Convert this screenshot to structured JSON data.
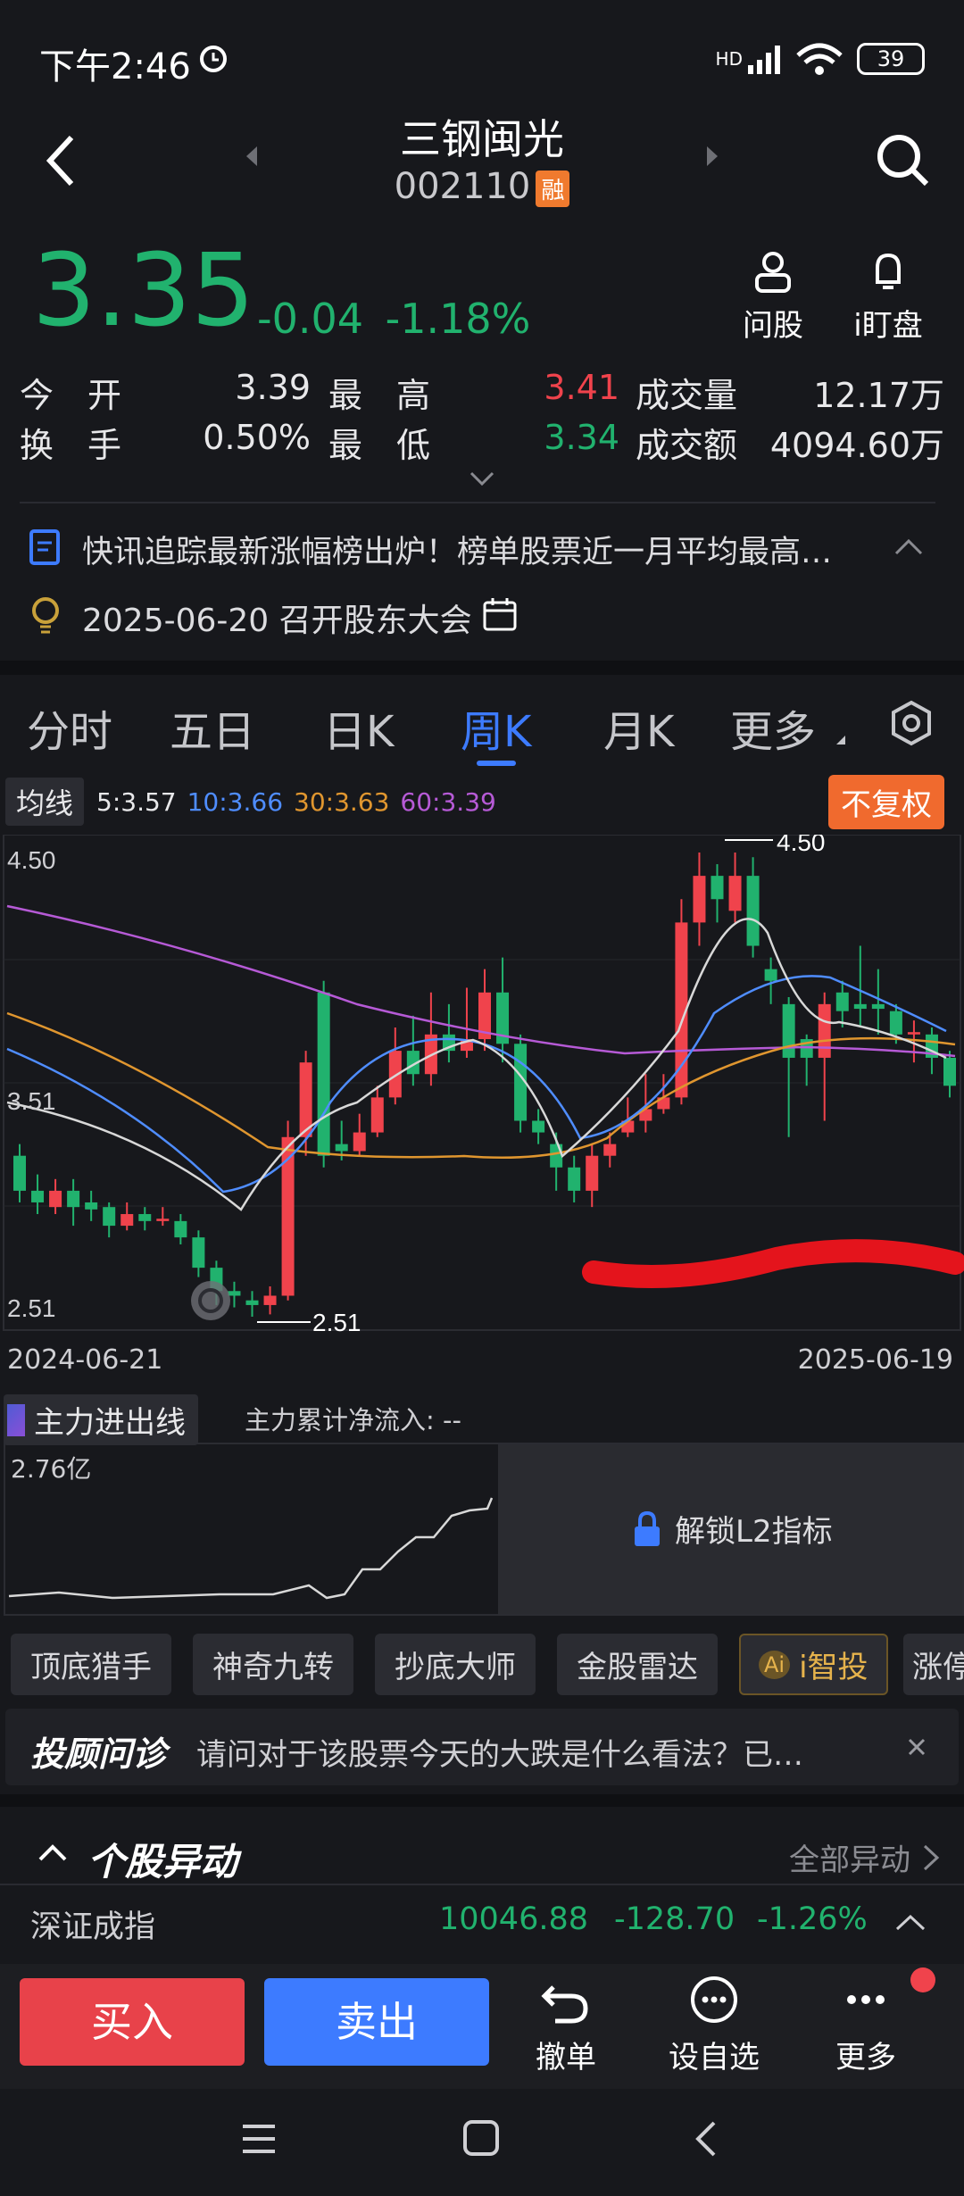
{
  "status": {
    "time": "下午2:46",
    "battery": "39",
    "network": "HD"
  },
  "header": {
    "title": "三钢闽光",
    "code": "002110",
    "margin_badge": "融"
  },
  "quote": {
    "price": "3.35",
    "change": "-0.04",
    "change_pct": "-1.18%",
    "actions": [
      {
        "label": "问股",
        "icon": "person-icon"
      },
      {
        "label": "i盯盘",
        "icon": "bell-icon"
      }
    ],
    "stats": {
      "open_label": "今　开",
      "open": "3.39",
      "high_label": "最　高",
      "high": "3.41",
      "volume_label": "成交量",
      "volume": "12.17万",
      "turnover_label": "换　手",
      "turnover": "0.50%",
      "low_label": "最　低",
      "low": "3.34",
      "amount_label": "成交额",
      "amount": "4094.60万"
    }
  },
  "news": {
    "text": "快讯追踪最新涨幅榜出炉！榜单股票近一月平均最高…",
    "event": "2025-06-20 召开股东大会"
  },
  "tabs": [
    {
      "label": "分时",
      "active": false
    },
    {
      "label": "五日",
      "active": false
    },
    {
      "label": "日K",
      "active": false
    },
    {
      "label": "周K",
      "active": true
    },
    {
      "label": "月K",
      "active": false
    },
    {
      "label": "更多",
      "active": false
    }
  ],
  "ma": {
    "selector": "均线",
    "items": [
      {
        "label": "5:3.57",
        "color": "#e6e6e6"
      },
      {
        "label": "10:3.66",
        "color": "#4f8dff"
      },
      {
        "label": "30:3.63",
        "color": "#e0962f"
      },
      {
        "label": "60:3.39",
        "color": "#b65ad6"
      }
    ],
    "adjust": "不复权"
  },
  "chart_data": {
    "type": "candlestick",
    "y_ticks": [
      "4.50",
      "3.51",
      "2.51"
    ],
    "x_start": "2024-06-21",
    "x_end": "2025-06-19",
    "annotations": [
      {
        "label": "4.50"
      },
      {
        "label": "2.51"
      }
    ],
    "ylim": [
      2.51,
      4.5
    ],
    "candles": [
      [
        3.2,
        3.05,
        3.25,
        3.0
      ],
      [
        3.05,
        3.0,
        3.12,
        2.95
      ],
      [
        2.98,
        3.05,
        3.1,
        2.95
      ],
      [
        3.05,
        2.98,
        3.1,
        2.9
      ],
      [
        3.0,
        2.97,
        3.05,
        2.92
      ],
      [
        2.98,
        2.9,
        3.0,
        2.85
      ],
      [
        2.9,
        2.95,
        3.0,
        2.88
      ],
      [
        2.95,
        2.92,
        2.98,
        2.88
      ],
      [
        2.92,
        2.93,
        2.98,
        2.9
      ],
      [
        2.92,
        2.85,
        2.95,
        2.82
      ],
      [
        2.85,
        2.72,
        2.88,
        2.68
      ],
      [
        2.72,
        2.62,
        2.75,
        2.56
      ],
      [
        2.62,
        2.6,
        2.66,
        2.55
      ],
      [
        2.58,
        2.56,
        2.62,
        2.51
      ],
      [
        2.56,
        2.6,
        2.64,
        2.52
      ],
      [
        2.6,
        3.28,
        3.35,
        2.58
      ],
      [
        3.28,
        3.6,
        3.65,
        3.2
      ],
      [
        3.9,
        3.2,
        3.95,
        3.15
      ],
      [
        3.25,
        3.22,
        3.35,
        3.18
      ],
      [
        3.22,
        3.3,
        3.38,
        3.2
      ],
      [
        3.3,
        3.45,
        3.5,
        3.28
      ],
      [
        3.45,
        3.65,
        3.75,
        3.42
      ],
      [
        3.65,
        3.55,
        3.8,
        3.5
      ],
      [
        3.55,
        3.72,
        3.9,
        3.5
      ],
      [
        3.72,
        3.65,
        3.85,
        3.6
      ],
      [
        3.65,
        3.7,
        3.92,
        3.62
      ],
      [
        3.7,
        3.9,
        4.0,
        3.65
      ],
      [
        3.9,
        3.68,
        4.05,
        3.6
      ],
      [
        3.68,
        3.35,
        3.72,
        3.3
      ],
      [
        3.35,
        3.3,
        3.4,
        3.25
      ],
      [
        3.25,
        3.15,
        3.3,
        3.05
      ],
      [
        3.15,
        3.05,
        3.2,
        3.0
      ],
      [
        3.05,
        3.2,
        3.25,
        2.98
      ],
      [
        3.2,
        3.25,
        3.3,
        3.15
      ],
      [
        3.3,
        3.35,
        3.45,
        3.28
      ],
      [
        3.35,
        3.4,
        3.55,
        3.3
      ],
      [
        3.4,
        3.45,
        3.55,
        3.38
      ],
      [
        3.45,
        4.2,
        4.3,
        3.42
      ],
      [
        4.2,
        4.4,
        4.5,
        4.1
      ],
      [
        4.4,
        4.3,
        4.45,
        4.2
      ],
      [
        4.25,
        4.4,
        4.5,
        4.2
      ],
      [
        4.4,
        4.1,
        4.48,
        4.05
      ],
      [
        4.0,
        3.95,
        4.05,
        3.85
      ],
      [
        3.85,
        3.62,
        3.88,
        3.28
      ],
      [
        3.7,
        3.62,
        3.72,
        3.5
      ],
      [
        3.62,
        3.85,
        3.9,
        3.35
      ],
      [
        3.9,
        3.82,
        3.95,
        3.75
      ],
      [
        3.85,
        3.83,
        4.1,
        3.75
      ],
      [
        3.85,
        3.83,
        4.0,
        3.72
      ],
      [
        3.82,
        3.72,
        3.85,
        3.68
      ],
      [
        3.72,
        3.73,
        3.78,
        3.6
      ],
      [
        3.72,
        3.62,
        3.75,
        3.55
      ],
      [
        3.62,
        3.5,
        3.65,
        3.45
      ]
    ]
  },
  "main_force": {
    "title": "主力进出线",
    "net_label": "主力累计净流入: --",
    "ymax": "2.76亿",
    "unlock": "解锁L2指标"
  },
  "tools": [
    "顶底猎手",
    "神奇九转",
    "抄底大师",
    "金股雷达",
    "i智投",
    "涨停"
  ],
  "advisor": {
    "title": "投顾问诊",
    "question": "请问对于该股票今天的大跌是什么看法？已…"
  },
  "anomaly": {
    "title": "个股异动",
    "all": "全部异动"
  },
  "index": {
    "name": "深证成指",
    "value": "10046.88",
    "change": "-128.70",
    "pct": "-1.26%"
  },
  "bottom": {
    "buy": "买入",
    "sell": "卖出",
    "items": [
      {
        "label": "撤单"
      },
      {
        "label": "设自选"
      },
      {
        "label": "更多"
      }
    ]
  }
}
